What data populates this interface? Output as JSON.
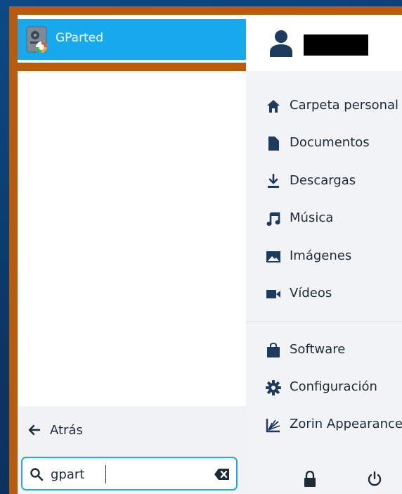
{
  "search_results": [
    {
      "label": "GParted",
      "icon": "gparted-icon"
    }
  ],
  "back_button": {
    "label": "Atrás",
    "icon": "arrow-left-icon"
  },
  "search": {
    "value": "gpart",
    "icon": "search-icon",
    "clear_icon": "backspace-icon"
  },
  "user": {
    "avatar_icon": "user-icon",
    "name": ""
  },
  "places": [
    {
      "label": "Carpeta personal",
      "icon": "home-icon"
    },
    {
      "label": "Documentos",
      "icon": "document-icon"
    },
    {
      "label": "Descargas",
      "icon": "download-icon"
    },
    {
      "label": "Música",
      "icon": "music-icon"
    },
    {
      "label": "Imágenes",
      "icon": "image-icon"
    },
    {
      "label": "Vídeos",
      "icon": "video-icon"
    }
  ],
  "system": [
    {
      "label": "Software",
      "icon": "software-bag-icon"
    },
    {
      "label": "Configuración",
      "icon": "gear-icon"
    },
    {
      "label": "Zorin Appearance",
      "icon": "zorin-appearance-icon"
    }
  ],
  "footer": {
    "lock_icon": "lock-icon",
    "power_icon": "power-icon"
  },
  "colors": {
    "accent": "#17a9ec",
    "highlight_border": "#b65c0c",
    "search_border": "#26a7e3",
    "icon_color": "#1d3b5c"
  }
}
